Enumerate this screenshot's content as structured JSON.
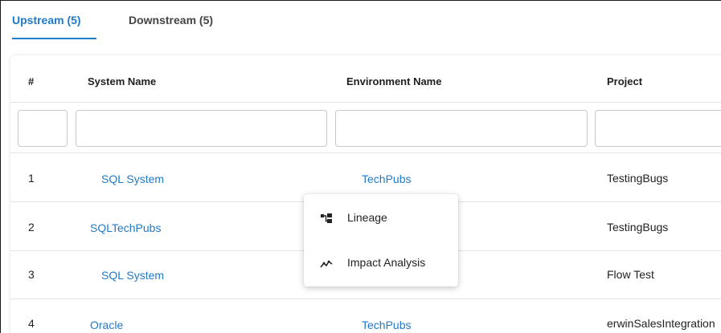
{
  "tabs": [
    {
      "label": "Upstream (5)",
      "active": true
    },
    {
      "label": "Downstream (5)",
      "active": false
    }
  ],
  "table": {
    "columns": [
      "#",
      "System Name",
      "Environment Name",
      "Project"
    ],
    "rows": [
      {
        "num": "1",
        "system": "SQL System",
        "environment": "TechPubs",
        "project": "TestingBugs"
      },
      {
        "num": "2",
        "system": "SQLTechPubs",
        "environment": "",
        "project": "TestingBugs"
      },
      {
        "num": "3",
        "system": "SQL System",
        "environment": "",
        "project": "Flow Test"
      },
      {
        "num": "4",
        "system": "Oracle",
        "environment": "TechPubs",
        "project": "erwinSalesIntegration"
      }
    ]
  },
  "context_menu": {
    "items": [
      {
        "label": "Lineage",
        "icon": "lineage-icon"
      },
      {
        "label": "Impact Analysis",
        "icon": "impact-analysis-icon"
      }
    ]
  },
  "colors": {
    "accent": "#1f7ac9",
    "text": "#222222",
    "border": "#c9c9c9"
  }
}
